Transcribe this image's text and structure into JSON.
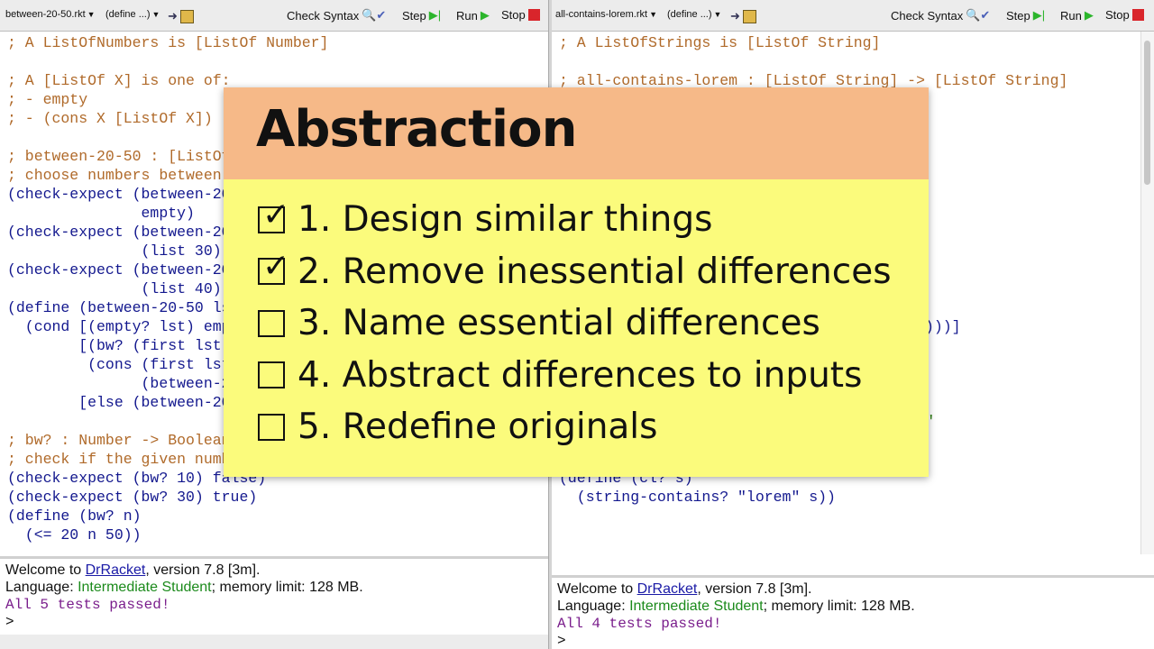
{
  "left": {
    "filename": "between-20-50.rkt",
    "define_menu": "(define ...)",
    "toolbar": {
      "check_syntax": "Check Syntax",
      "step": "Step",
      "run": "Run",
      "stop": "Stop"
    },
    "code": [
      {
        "t": "; A ListOfNumbers is [ListOf Number]",
        "c": "cmt"
      },
      {
        "t": "",
        "c": ""
      },
      {
        "t": "; A [ListOf X] is one of:",
        "c": "cmt"
      },
      {
        "t": "; - empty",
        "c": "cmt"
      },
      {
        "t": "; - (cons X [ListOf X])",
        "c": "cmt"
      },
      {
        "t": "",
        "c": ""
      },
      {
        "t": "; between-20-50 : [ListOf Number] -> [ListOf Number]",
        "c": "cmt"
      },
      {
        "t": "; choose numbers between 20 and 50",
        "c": "cmt"
      },
      {
        "t": "(check-expect (between-20-50 empty)",
        "c": ""
      },
      {
        "t": "               empty)",
        "c": ""
      },
      {
        "t": "(check-expect (between-20-50 (list 30))",
        "c": ""
      },
      {
        "t": "               (list 30))",
        "c": ""
      },
      {
        "t": "(check-expect (between-20-50 (list 40 10))",
        "c": ""
      },
      {
        "t": "               (list 40))",
        "c": ""
      },
      {
        "t": "(define (between-20-50 lst)",
        "c": ""
      },
      {
        "t": "  (cond [(empty? lst) empty]",
        "c": ""
      },
      {
        "t": "        [(bw? (first lst))",
        "c": ""
      },
      {
        "t": "         (cons (first lst)",
        "c": ""
      },
      {
        "t": "               (between-20-50 (rest lst)))]",
        "c": ""
      },
      {
        "t": "        [else (between-20-50 (rest lst))]))",
        "c": ""
      },
      {
        "t": "",
        "c": ""
      },
      {
        "t": "; bw? : Number -> Boolean",
        "c": "cmt"
      },
      {
        "t": "; check if the given number is between 20 and 50",
        "c": "cmt"
      },
      {
        "t": "(check-expect (bw? 10) false)",
        "c": ""
      },
      {
        "t": "(check-expect (bw? 30) true)",
        "c": ""
      },
      {
        "t": "(define (bw? n)",
        "c": ""
      },
      {
        "t": "  (<= 20 n 50))",
        "c": ""
      }
    ],
    "welcome_prefix": "Welcome to ",
    "welcome_link": "DrRacket",
    "welcome_suffix": ", version 7.8 [3m].",
    "language_prefix": "Language: ",
    "language_name": "Intermediate Student",
    "language_suffix": "; memory limit: 128 MB.",
    "result": "All 5 tests passed!",
    "prompt": ">"
  },
  "right": {
    "filename": "all-contains-lorem.rkt",
    "define_menu": "(define ...)",
    "toolbar": {
      "check_syntax": "Check Syntax",
      "step": "Step",
      "run": "Run",
      "stop": "Stop"
    },
    "code": [
      {
        "t": "; A ListOfStrings is [ListOf String]",
        "c": "cmt"
      },
      {
        "t": "",
        "c": ""
      },
      {
        "t": "; all-contains-lorem : [ListOf String] -> [ListOf String]",
        "c": "cmt"
      },
      {
        "t": "",
        "c": ""
      },
      {
        "t": "                                   empty)",
        "c": ""
      },
      {
        "t": "",
        "c": ""
      },
      {
        "t": "",
        "c": ""
      },
      {
        "t": "",
        "c": ""
      },
      {
        "t": "",
        "c": ""
      },
      {
        "t": "",
        "c": ""
      },
      {
        "t": "",
        "c": ""
      },
      {
        "t": "",
        "c": ""
      },
      {
        "t": "",
        "c": ""
      },
      {
        "t": "",
        "c": ""
      },
      {
        "t": "",
        "c": ""
      },
      {
        "t": "                                       st)))]",
        "c": ""
      },
      {
        "t": "",
        "c": ""
      },
      {
        "t": "                                        )",
        "c": ""
      },
      {
        "t": "",
        "c": ""
      },
      {
        "t": "",
        "c": ""
      },
      {
        "t": "                                   \"lorem\"",
        "c": "str"
      },
      {
        "t": "                                       e)",
        "c": ""
      },
      {
        "t": "",
        "c": ""
      },
      {
        "t": "(define (cl? s)",
        "c": ""
      },
      {
        "t": "  (string-contains? \"lorem\" s))",
        "c": ""
      }
    ],
    "welcome_prefix": "Welcome to ",
    "welcome_link": "DrRacket",
    "welcome_suffix": ", version 7.8 [3m].",
    "language_prefix": "Language: ",
    "language_name": "Intermediate Student",
    "language_suffix": "; memory limit: 128 MB.",
    "result": "All 4 tests passed!",
    "prompt": ">"
  },
  "overlay": {
    "title": "Abstraction",
    "steps": [
      {
        "label": "1. Design similar things",
        "checked": true
      },
      {
        "label": "2. Remove inessential differences",
        "checked": true
      },
      {
        "label": "3. Name essential differences",
        "checked": false
      },
      {
        "label": "4. Abstract differences to inputs",
        "checked": false
      },
      {
        "label": "5. Redefine originals",
        "checked": false
      }
    ]
  },
  "icons": {
    "check_syntax": "magnifier-check-icon",
    "step": "step-icon",
    "run": "run-icon",
    "stop": "stop-icon"
  },
  "colors": {
    "overlay_header": "#f6b988",
    "overlay_body": "#fbfb7c",
    "comment": "#b06a2a",
    "language": "#1b8a1b",
    "test_result": "#7a1e8c"
  }
}
